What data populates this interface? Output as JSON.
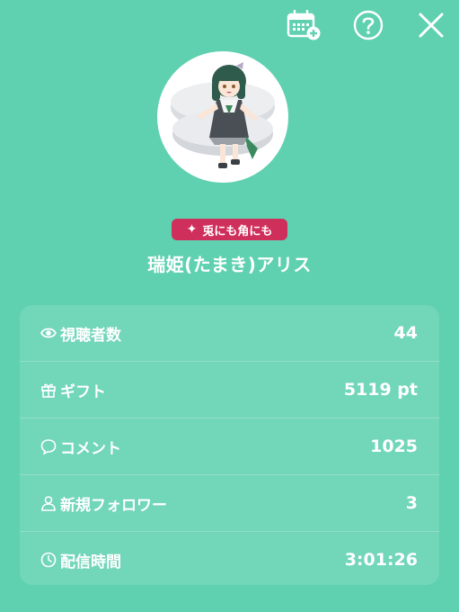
{
  "header": {
    "icons": [
      "calendar-plus-icon",
      "help-icon",
      "close-icon"
    ]
  },
  "profile": {
    "tag": "兎にも角にも",
    "name": "瑞姫(たまき)アリス"
  },
  "stats": [
    {
      "icon": "eye-icon",
      "label": "視聴者数",
      "value": "44"
    },
    {
      "icon": "gift-icon",
      "label": "ギフト",
      "value": "5119 pt"
    },
    {
      "icon": "comment-icon",
      "label": "コメント",
      "value": "1025"
    },
    {
      "icon": "person-icon",
      "label": "新規フォロワー",
      "value": "3"
    },
    {
      "icon": "clock-icon",
      "label": "配信時間",
      "value": "3:01:26"
    }
  ],
  "colors": {
    "background": "#5fd1b0",
    "tag_background": "#cf2f5b",
    "text": "#ffffff"
  }
}
